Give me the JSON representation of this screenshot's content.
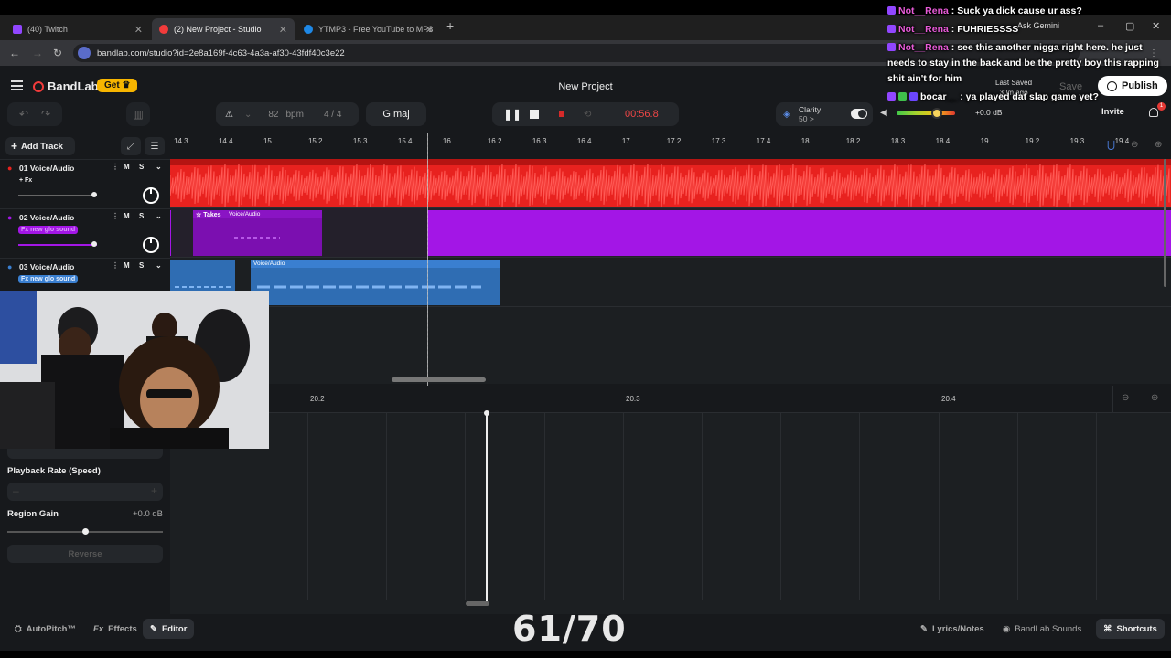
{
  "browser": {
    "tabs": [
      {
        "title": "(40) Twitch",
        "color": "#9146ff"
      },
      {
        "title": "(2) New Project - Studio",
        "color": "#f23b3b"
      },
      {
        "title": "YTMP3 - Free YouTube to MP3",
        "color": "#1e88e5"
      }
    ],
    "ask_gemini": "Ask Gemini",
    "url": "bandlab.com/studio?id=2e8a169f-4c63-4a3a-af30-43fdf40c3e22"
  },
  "app": {
    "logo": "BandLab",
    "get_label": "Get",
    "project_title": "New Project",
    "last_saved_label": "Last Saved",
    "last_saved_value": "30m ago",
    "save_label": "Save",
    "publish_label": "Publish",
    "invite_label": "Invite",
    "notification_count": "1"
  },
  "transport": {
    "bpm": "82",
    "bpm_unit": "bpm",
    "time_signature": "4 / 4",
    "key": "G maj",
    "time": "00:56.8",
    "clarity_label": "Clarity",
    "clarity_value": "50 >",
    "master_volume": "+0.0 dB",
    "master_volume_level": 0.6
  },
  "timeline": {
    "add_track_label": "Add Track",
    "ticks": [
      "14.3",
      "14.4",
      "15",
      "15.2",
      "15.3",
      "15.4",
      "16",
      "16.2",
      "16.3",
      "16.4",
      "17",
      "17.2",
      "17.3",
      "17.4",
      "18",
      "18.2",
      "18.3",
      "18.4",
      "19",
      "19.2",
      "19.3",
      "19.4"
    ]
  },
  "tracks": [
    {
      "name": "01  Voice/Audio",
      "fx_label": "+ Fx",
      "color": "#e8221f"
    },
    {
      "name": "02  Voice/Audio",
      "fx_label": "Fx new glo sound",
      "color": "#a316e6"
    },
    {
      "name": "03  Voice/Audio",
      "fx_label": "Fx new glo sound",
      "color": "#3a7fd0"
    }
  ],
  "regions": {
    "takes_label": "Takes",
    "track2_region_label": "Voice/Audio",
    "track3_region_label": "Voice/Audio"
  },
  "editor": {
    "ticks": [
      "20.2",
      "20.3",
      "20.4"
    ],
    "playback_rate_label": "Playback Rate (Speed)",
    "region_gain_label": "Region Gain",
    "region_gain_value": "+0.0 dB",
    "reverse_label": "Reverse"
  },
  "bottom": {
    "autopitch": "AutoPitch™",
    "effects": "Effects",
    "editor": "Editor",
    "lyrics": "Lyrics/Notes",
    "sounds": "BandLab Sounds",
    "shortcuts": "Shortcuts"
  },
  "overlay_counter": "61/70",
  "chat": [
    {
      "user": "Not__Rena",
      "text": ": Suck ya dick cause ur ass?"
    },
    {
      "user": "Not__Rena",
      "text": ": FUHRIESSSS"
    },
    {
      "user": "Not__Rena",
      "text": ": see this another nigga right here. he just needs to stay in the back and be the pretty boy this rapping shit ain't for him"
    },
    {
      "user": "bocar__",
      "text": ": ya played dat slap game yet?"
    }
  ]
}
